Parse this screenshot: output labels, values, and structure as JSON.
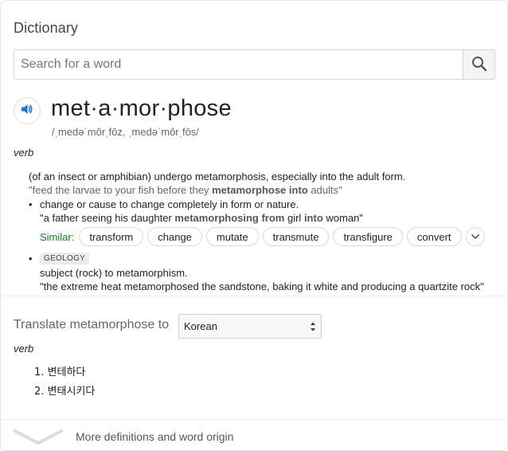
{
  "header": {
    "title": "Dictionary"
  },
  "search": {
    "placeholder": "Search for a word",
    "value": ""
  },
  "entry": {
    "headword": "met·a·mor·phose",
    "phonetic": "/ˌmedəˈmôrˌfōz, ˌmedəˈmôrˌfōs/",
    "part_of_speech": "verb",
    "definition_1": {
      "text": "(of an insect or amphibian) undergo metamorphosis, especially into the adult form.",
      "example_pre": "\"feed the larvae to your fish before they ",
      "example_bold": "metamorphose into",
      "example_post": " adults\""
    },
    "definition_2": {
      "bullet": "•",
      "text": "change or cause to change completely in form or nature.",
      "example_pre": "\"a father seeing his daughter ",
      "example_bold1": "metamorphosing from",
      "example_mid": " girl ",
      "example_bold2": "into",
      "example_post": " woman\""
    },
    "similar": {
      "label": "Similar:",
      "words": [
        "transform",
        "change",
        "mutate",
        "transmute",
        "transfigure",
        "convert"
      ]
    },
    "definition_3": {
      "bullet": "•",
      "tag": "GEOLOGY",
      "text": "subject (rock) to metamorphism.",
      "example": "\"the extreme heat metamorphosed the sandstone, baking it white and producing a quartzite rock\""
    }
  },
  "translate": {
    "label": "Translate metamorphose to",
    "language": "Korean",
    "part_of_speech": "verb",
    "items": [
      "1. 변테하다",
      "2. 변태시키다"
    ]
  },
  "footer": {
    "more_label": "More definitions and word origin"
  },
  "colors": {
    "accent_blue": "#1a73e8",
    "similar_green": "#1a7b1a"
  },
  "icons": {
    "search": "search-icon",
    "speaker": "speaker-icon",
    "chevron": "chevron-down-icon"
  }
}
